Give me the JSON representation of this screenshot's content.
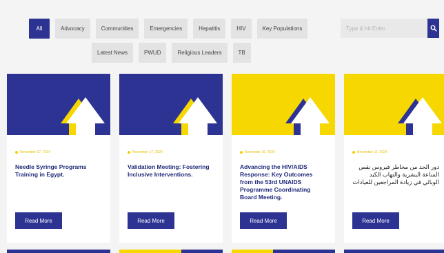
{
  "filters": {
    "row1": [
      "All",
      "Advocacy",
      "Communities",
      "Emergencies",
      "Hepatitis",
      "HIV",
      "Key Populations"
    ],
    "row2": [
      "Latest News",
      "PWUD",
      "Religious Leaders",
      "TB"
    ],
    "active": "All"
  },
  "search": {
    "placeholder": "Type & hit Enter",
    "icon": "search-icon"
  },
  "colors": {
    "brand_blue": "#2c3392",
    "brand_yellow": "#f6d800",
    "white": "#ffffff"
  },
  "cards": [
    {
      "thumb_bg": "blue",
      "date": "November 17, 2024",
      "title": "Needle Syringe Programs Training in Egypt.",
      "button": "Read More"
    },
    {
      "thumb_bg": "blue",
      "date": "November 17, 2024",
      "title": "Validation Meeting: Fostering Inclusive Interventions.",
      "button": "Read More"
    },
    {
      "thumb_bg": "yellow",
      "date": "November 16, 2024",
      "title": "Advancing the HIV/AIDS Response: Key Outcomes from the 53rd UNAIDS Programme Coordinating Board Meeting.",
      "button": "Read More"
    },
    {
      "thumb_bg": "yellow",
      "date": "November 11, 2024",
      "title": "دور الحد من مخاطر فيروس نقص المناعة البشرية والتهاب الكبد الوبائي في زيادة المراجعين للعيادات",
      "button": "Read More"
    }
  ]
}
